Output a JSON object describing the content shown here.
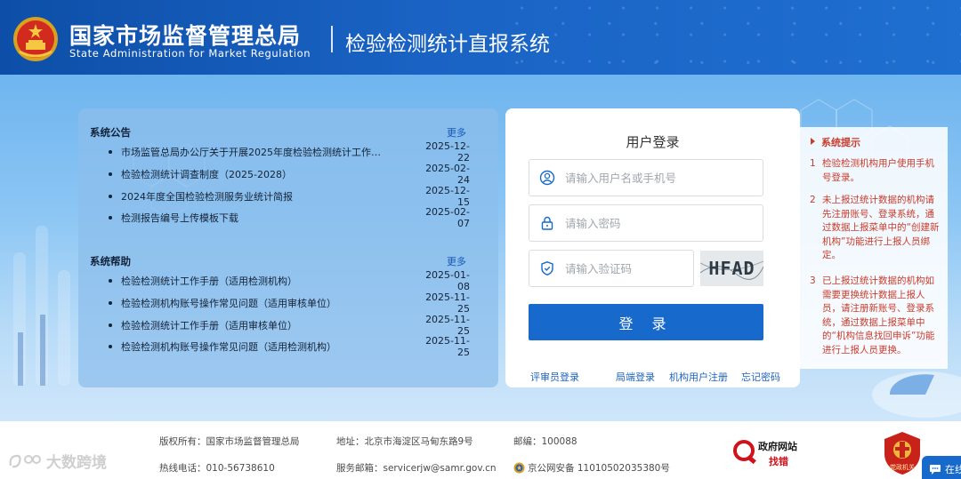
{
  "header": {
    "agency_cn": "国家市场监督管理总局",
    "agency_en": "State Administration  for  Market Regulation",
    "system_title": "检验检测统计直报系统"
  },
  "notices": {
    "title": "系统公告",
    "more": "更多",
    "items": [
      {
        "text": "市场监管总局办公厅关于开展2025年度检验检测统计工作…",
        "date": "2025-12-22"
      },
      {
        "text": "检验检测统计调查制度（2025-2028）",
        "date": "2025-02-24"
      },
      {
        "text": "2024年度全国检验检测服务业统计简报",
        "date": "2025-12-15"
      },
      {
        "text": "检测报告编号上传模板下载",
        "date": "2025-02-07"
      }
    ]
  },
  "help": {
    "title": "系统帮助",
    "more": "更多",
    "items": [
      {
        "text": "检验检测统计工作手册（适用检测机构）",
        "date": "2025-01-08"
      },
      {
        "text": "检验检测机构账号操作常见问题（适用审核单位）",
        "date": "2025-11-25"
      },
      {
        "text": "检验检测统计工作手册（适用审核单位）",
        "date": "2025-11-25"
      },
      {
        "text": "检验检测机构账号操作常见问题（适用检测机构）",
        "date": "2025-11-25"
      }
    ]
  },
  "login": {
    "title": "用户登录",
    "username_placeholder": "请输入用户名或手机号",
    "password_placeholder": "请输入密码",
    "captcha_placeholder": "请输入验证码",
    "captcha_text": "HFAD",
    "submit": "登 录",
    "links": {
      "reviewer": "评审员登录",
      "bureau": "局端登录",
      "register": "机构用户注册",
      "forgot": "忘记密码"
    }
  },
  "tips": {
    "title": "系统提示",
    "items": [
      {
        "num": "1",
        "text": "检验检测机构用户使用手机号登录。"
      },
      {
        "num": "2",
        "text": "未上报过统计数据的机构请先注册账号、登录系统，通过数据上报菜单中的“创建新机构”功能进行上报人员绑定。"
      },
      {
        "num": "3",
        "text": "已上报过统计数据的机构如需要更换统计数据上报人员，请注册新账号、登录系统，通过数据上报菜单中的“机构信息找回申诉”功能进行上报人员更换。"
      }
    ]
  },
  "footer": {
    "copyright": "版权所有：国家市场监督管理总局",
    "address": "地址：北京市海淀区马甸东路9号",
    "postcode": "邮编：100088",
    "hotline": "热线电话：010-56738610",
    "email": "服务邮箱：servicerjw@samr.gov.cn",
    "icp": "京公网安备 11010502035380号",
    "gov_badge_line1": "政府网站",
    "gov_badge_line2": "找错",
    "party_badge_text": "党政机关",
    "watermark": "大数跨境",
    "online_chat": "在线"
  },
  "colors": {
    "header_blue": "#1a63c4",
    "button_blue": "#1769cc",
    "tip_red": "#c93b2c"
  }
}
